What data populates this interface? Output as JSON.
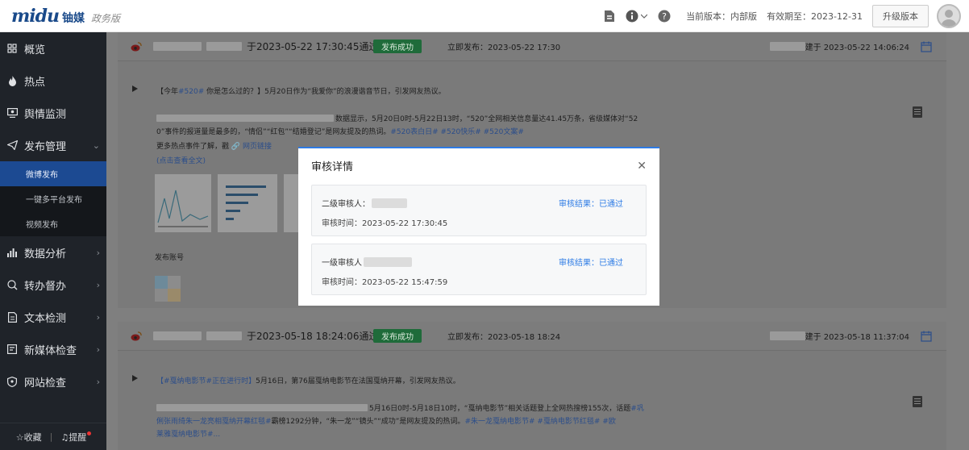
{
  "app": {
    "logo_main": "midu",
    "logo_cn": "铀媒",
    "logo_sub": "政务版"
  },
  "topbar": {
    "version_label": "当前版本：内部版",
    "expiry_label": "有效期至：2023-12-31",
    "upgrade_label": "升级版本"
  },
  "sidebar": {
    "items": [
      {
        "label": "概览",
        "icon": "grid-icon"
      },
      {
        "label": "热点",
        "icon": "flame-icon"
      },
      {
        "label": "舆情监测",
        "icon": "monitor-icon"
      },
      {
        "label": "发布管理",
        "icon": "send-icon"
      },
      {
        "label": "数据分析",
        "icon": "bar-chart-icon"
      },
      {
        "label": "转办督办",
        "icon": "transfer-icon"
      },
      {
        "label": "文本检测",
        "icon": "document-icon"
      },
      {
        "label": "新媒体检查",
        "icon": "media-icon"
      },
      {
        "label": "网站检查",
        "icon": "web-icon"
      }
    ],
    "sub_items": [
      {
        "label": "微博发布",
        "active": true
      },
      {
        "label": "一键多平台发布",
        "active": false
      },
      {
        "label": "视频发布",
        "active": false
      }
    ],
    "footer": {
      "favorites_label": "收藏",
      "reminder_label": "提醒"
    }
  },
  "posts": [
    {
      "title_suffix": "于2023-05-22 17:30:45通过",
      "status": "发布成功",
      "publish_time": "立即发布：2023-05-22 17:30",
      "created_suffix": "建于 2023-05-22 14:06:24",
      "line1_pre": "【今年",
      "line1_tag": "#520#",
      "line1_post": " 你是怎么过的？】5月20日作为“我爱你”的浪漫谐音节日，引发网友热议。",
      "line2_post": "数据显示，5月20日0时-5月22日13时，“520”全网相关信息量达41.45万条，省级媒体对“52",
      "line3_pre": "0”事件的报道量是最多的，“情侣”“红包”“结婚登记”是网友提及的热词。",
      "line3_tags": "#520表白日# #520快乐# #520文案#",
      "line4_pre": "更多热点事件了解，戳 ",
      "line4_link": "🔗 网页链接",
      "line5_link": "(点击查看全文)",
      "account_label": "发布账号"
    },
    {
      "title_suffix": "于2023-05-18 18:24:06通过",
      "status": "发布成功",
      "publish_time": "立即发布：2023-05-18 18:24",
      "created_suffix": "建于 2023-05-18 11:37:04",
      "line1_tag": "【#戛纳电影节#正在进行时】",
      "line1_post": "5月16日，第76届戛纳电影节在法国戛纳开幕，引发网友热议。",
      "line2_post": "5月16日0时-5月18日10时，“戛纳电影节”相关话题登上全网热搜榜155次，话题",
      "line2_tag": "#巩",
      "line3_tags": "俐张雨绮朱一龙亮相戛纳开幕红毯#",
      "line3_mid": "霸榜1292分钟，“朱一龙”“镜头”“成功”是网友提及的热词。",
      "line3_tags2": "#朱一龙戛纳电影节# #戛纳电影节红毯# #欧",
      "line4_tags": "莱雅戛纳电影节#..."
    }
  ],
  "modal": {
    "title": "审核详情",
    "reviews": [
      {
        "level_label": "二级审核人：",
        "result": "审核结果：已通过",
        "time": "审核时间：2023-05-22 17:30:45"
      },
      {
        "level_label": "一级审核人",
        "result": "审核结果：已通过",
        "time": "审核时间：2023-05-22 15:47:59"
      }
    ]
  },
  "colors": {
    "accent": "#2d7be5",
    "sidebar_bg": "#1f2329",
    "sidebar_active": "#1c4a92",
    "success": "#1f6b3a"
  }
}
